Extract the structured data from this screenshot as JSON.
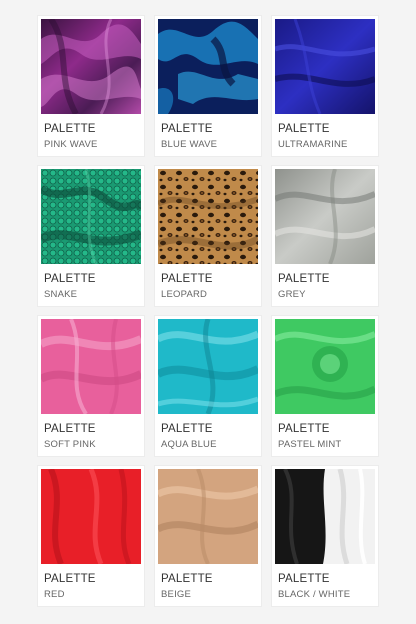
{
  "products": [
    {
      "brand": "PALETTE",
      "name": "PINK WAVE"
    },
    {
      "brand": "PALETTE",
      "name": "BLUE WAVE"
    },
    {
      "brand": "PALETTE",
      "name": "ULTRAMARINE"
    },
    {
      "brand": "PALETTE",
      "name": "SNAKE"
    },
    {
      "brand": "PALETTE",
      "name": "LEOPARD"
    },
    {
      "brand": "PALETTE",
      "name": "GREY"
    },
    {
      "brand": "PALETTE",
      "name": "SOFT PINK"
    },
    {
      "brand": "PALETTE",
      "name": "AQUA BLUE"
    },
    {
      "brand": "PALETTE",
      "name": "PASTEL MINT"
    },
    {
      "brand": "PALETTE",
      "name": "RED"
    },
    {
      "brand": "PALETTE",
      "name": "BEIGE"
    },
    {
      "brand": "PALETTE",
      "name": "BLACK / WHITE"
    }
  ]
}
